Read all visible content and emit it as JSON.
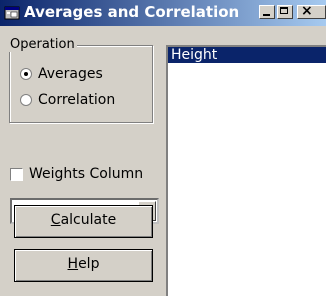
{
  "window": {
    "title": "Averages and Correlation",
    "controls": [
      "minimize",
      "maximize",
      "close"
    ]
  },
  "operation_group": {
    "label": "Operation",
    "options": [
      {
        "label": "Averages",
        "checked": true
      },
      {
        "label": "Correlation",
        "checked": false
      }
    ]
  },
  "weights": {
    "label": "Weights Column",
    "checked": false
  },
  "weights_combo": {
    "value": ""
  },
  "buttons": {
    "calculate_mnemonic": "C",
    "calculate_rest": "alculate",
    "help_mnemonic": "H",
    "help_rest": "elp"
  },
  "list": {
    "items": [
      "Height"
    ],
    "selected_index": 0
  },
  "icons": {
    "app": "app-window-icon",
    "min": "minimize-icon",
    "max": "maximize-icon",
    "close": "close-icon",
    "dropdown": "chevron-down-icon"
  },
  "colors": {
    "title_bar": "#0a246a",
    "selection": "#0a246a",
    "face": "#d4d0c8"
  }
}
